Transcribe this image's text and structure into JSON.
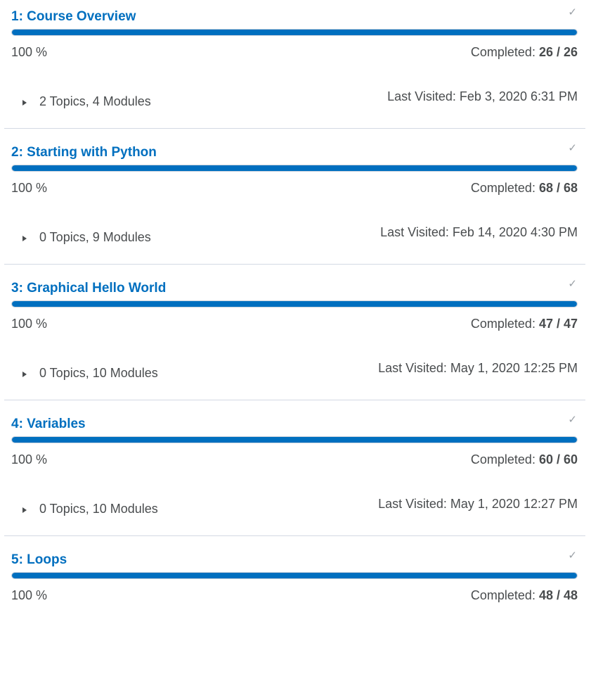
{
  "units": [
    {
      "title": "1: Course Overview",
      "percent_label": "100 %",
      "progress": 1.0,
      "completed_label": "Completed: ",
      "completed_value": "26 / 26",
      "topics": "2 Topics, 4 Modules",
      "last_visited": "Last Visited: Feb 3, 2020 6:31 PM",
      "check_icon": "checkmark-icon"
    },
    {
      "title": "2: Starting with Python",
      "percent_label": "100 %",
      "progress": 1.0,
      "completed_label": "Completed: ",
      "completed_value": "68 / 68",
      "topics": "0 Topics, 9 Modules",
      "last_visited": "Last Visited: Feb 14, 2020 4:30 PM",
      "check_icon": "checkmark-icon"
    },
    {
      "title": "3: Graphical Hello World",
      "percent_label": "100 %",
      "progress": 1.0,
      "completed_label": "Completed: ",
      "completed_value": "47 / 47",
      "topics": "0 Topics, 10 Modules",
      "last_visited": "Last Visited: May 1, 2020 12:25 PM",
      "check_icon": "checkmark-icon"
    },
    {
      "title": "4: Variables",
      "percent_label": "100 %",
      "progress": 1.0,
      "completed_label": "Completed: ",
      "completed_value": "60 / 60",
      "topics": "0 Topics, 10 Modules",
      "last_visited": "Last Visited: May 1, 2020 12:27 PM",
      "check_icon": "checkmark-icon"
    },
    {
      "title": "5: Loops",
      "percent_label": "100 %",
      "progress": 1.0,
      "completed_label": "Completed: ",
      "completed_value": "48 / 48",
      "check_icon": "checkmark-icon"
    }
  ],
  "colors": {
    "accent": "#006fbf",
    "text": "#494c4e",
    "divider": "#d3d9e3",
    "check": "#9aa0a6"
  }
}
